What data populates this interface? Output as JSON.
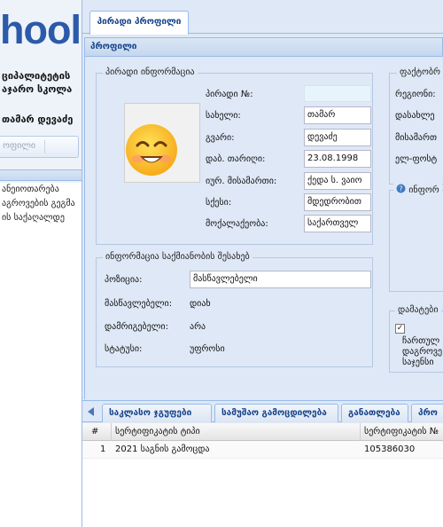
{
  "sidebar": {
    "logo": "hool",
    "school_name_line1": "ციპალიტეტის",
    "school_name_line2": "აჯარო სკოლა",
    "user_name": "თამარ დევაძე",
    "profile_button": "ოფილი",
    "nav_items": [
      "ანეიოთარება",
      "აგროვების გეგმა",
      "ის საქაღალდე"
    ]
  },
  "main": {
    "tab_label": "პირადი პროფილი",
    "panel_title": "პროფილი",
    "personal_info": {
      "legend": "პირადი ინფორმაცია",
      "fields": [
        {
          "label": "პირადი №:",
          "value": ""
        },
        {
          "label": "სახელი:",
          "value": "თამარ"
        },
        {
          "label": "გვარი:",
          "value": "დევაძე"
        },
        {
          "label": "დაბ. თარიღი:",
          "value": "23.08.1998"
        },
        {
          "label": "იურ. მისამართი:",
          "value": "ქედა ს. ვაიო"
        },
        {
          "label": "სქესი:",
          "value": "მდედრობით"
        },
        {
          "label": "მოქალაქეობა:",
          "value": "საქართველ"
        }
      ]
    },
    "employment_info": {
      "legend": "ინფორმაცია საქმიანობის შესახებ",
      "position_label": "პოზიცია:",
      "position_value": "მასწავლებელი",
      "rows": [
        {
          "label": "მასწავლებელი:",
          "value": "დიახ"
        },
        {
          "label": "დამრიგებელი:",
          "value": "არა"
        },
        {
          "label": "სტატუსი:",
          "value": "უფროსი"
        }
      ]
    },
    "actual_address": {
      "legend": "ფაქტობრ",
      "labels": [
        "რეგიონი:",
        "დასახლე",
        "მისამართ",
        "ელ-ფოსტ"
      ]
    },
    "info_box": {
      "legend": "ინფორ"
    },
    "additional": {
      "legend": "დამატები",
      "checked": true,
      "checkbox_mark": "✓",
      "text_lines": [
        "ჩართულ",
        "დაგროვე",
        "საჯენსი"
      ]
    }
  },
  "grid": {
    "tabs": [
      "საკლასო ჯგუფები",
      "სამუშაო გამოცდილება",
      "განათლება",
      "პრო"
    ],
    "columns": [
      "#",
      "სერტიფიკატის ტიპი",
      "სერტიფიკატის №"
    ],
    "rows": [
      {
        "num": "1",
        "type": "2021 საგნის გამოცდა",
        "number": "105386030"
      }
    ]
  }
}
